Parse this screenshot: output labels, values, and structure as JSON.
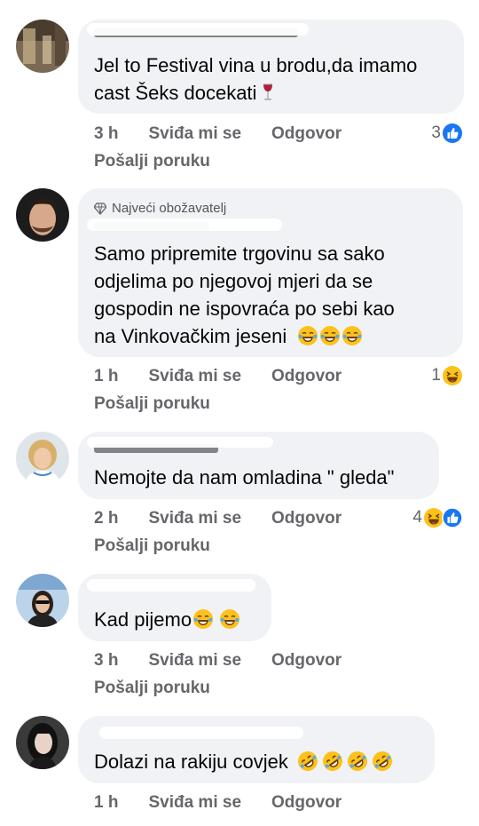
{
  "comments": [
    {
      "text_lines": [
        "Jel to Festival vina u brodu,da imamo",
        "cast Šeks docekati"
      ],
      "badge": "",
      "time": "3 h",
      "like_label": "Sviđa mi se",
      "reply_label": "Odgovor",
      "send_label": "Pošalji poruku",
      "reaction_count": "3",
      "reactions": [
        "like-icon"
      ],
      "trailing_emojis": [
        "wine-glass-icon"
      ]
    },
    {
      "text_lines": [
        "Samo pripremite trgovinu sa sako",
        "odjelima po njegovoj mjeri da se",
        "gospodin ne ispovraća po sebi kao",
        "na Vinkovačkim jeseni"
      ],
      "badge": "Najveći obožavatelj",
      "time": "1 h",
      "like_label": "Sviđa mi se",
      "reply_label": "Odgovor",
      "send_label": "Pošalji poruku",
      "reaction_count": "1",
      "reactions": [
        "haha-icon"
      ],
      "trailing_emojis": [
        "tears-of-joy-icon",
        "tears-of-joy-icon",
        "tears-of-joy-icon"
      ]
    },
    {
      "text_lines": [
        "Nemojte da nam omladina \" gleda\""
      ],
      "badge": "",
      "time": "2 h",
      "like_label": "Sviđa mi se",
      "reply_label": "Odgovor",
      "send_label": "Pošalji poruku",
      "reaction_count": "4",
      "reactions": [
        "haha-icon",
        "like-icon"
      ],
      "trailing_emojis": []
    },
    {
      "text_lines": [
        "Kad pijemo"
      ],
      "badge": "",
      "time": "3 h",
      "like_label": "Sviđa mi se",
      "reply_label": "Odgovor",
      "send_label": "Pošalji poruku",
      "reaction_count": "",
      "reactions": [],
      "trailing_emojis": [
        "tears-of-joy-icon",
        "tears-of-joy-icon"
      ]
    },
    {
      "text_lines": [
        "Dolazi na rakiju covjek"
      ],
      "badge": "",
      "time": "1 h",
      "like_label": "Sviđa mi se",
      "reply_label": "Odgovor",
      "send_label": "",
      "reaction_count": "",
      "reactions": [],
      "trailing_emojis": [
        "rofl-icon",
        "rofl-icon",
        "rofl-icon",
        "rofl-icon"
      ]
    }
  ],
  "colors": {
    "bubble": "#f0f2f5",
    "meta_text": "#65676b",
    "like_blue": "#1877f2",
    "emoji_yellow": "#fcc21b"
  }
}
